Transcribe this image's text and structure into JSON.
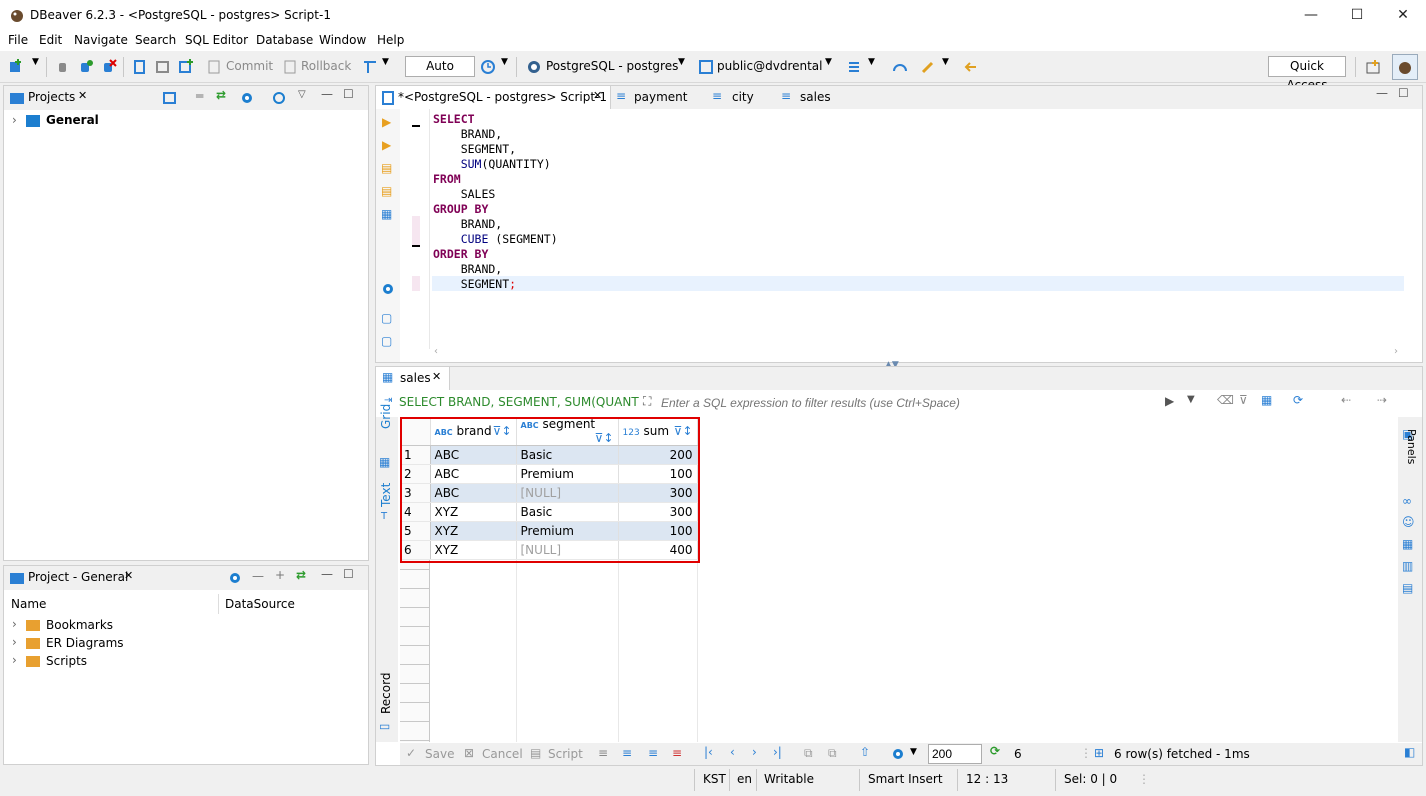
{
  "window": {
    "title": "DBeaver 6.2.3 - <PostgreSQL - postgres> Script-1",
    "minimize": "—",
    "maximize": "☐",
    "close": "✕"
  },
  "menu": [
    "File",
    "Edit",
    "Navigate",
    "Search",
    "SQL Editor",
    "Database",
    "Window",
    "Help"
  ],
  "toolbar": {
    "commit": "Commit",
    "rollback": "Rollback",
    "transaction_mode": "Auto",
    "connection": "PostgreSQL - postgres",
    "schema": "public@dvdrental",
    "quick_access": "Quick Access"
  },
  "projects_panel": {
    "title": "Projects",
    "items": [
      {
        "label": "General"
      }
    ]
  },
  "project_general_panel": {
    "title": "Project - General",
    "columns": [
      "Name",
      "DataSource"
    ],
    "items": [
      {
        "label": "Bookmarks"
      },
      {
        "label": "ER Diagrams"
      },
      {
        "label": "Scripts"
      }
    ]
  },
  "editor_tabs": [
    {
      "label": "*<PostgreSQL - postgres> Script-1",
      "active": true
    },
    {
      "label": "payment"
    },
    {
      "label": "city"
    },
    {
      "label": "sales"
    }
  ],
  "sql_lines": [
    {
      "kw": "SELECT"
    },
    {
      "text": "    BRAND,"
    },
    {
      "text": "    SEGMENT,"
    },
    {
      "fn": "    SUM",
      "text": "(QUANTITY)"
    },
    {
      "kw": "FROM"
    },
    {
      "text": "    SALES"
    },
    {
      "kw": "GROUP BY"
    },
    {
      "text": "    BRAND,"
    },
    {
      "fn": "    CUBE",
      "text": " (SEGMENT)"
    },
    {
      "kw": "ORDER BY"
    },
    {
      "text": "    BRAND,"
    },
    {
      "text": "    SEGMENT",
      "semi": ";"
    }
  ],
  "results": {
    "tab": "sales",
    "query_text": "SELECT BRAND, SEGMENT, SUM(QUANTITY",
    "filter_placeholder": "Enter a SQL expression to filter results (use Ctrl+Space)",
    "side_tabs": {
      "grid": "Grid",
      "text": "Text",
      "record": "Record",
      "panels": "Panels"
    },
    "columns": [
      {
        "type": "ABC",
        "name": "brand"
      },
      {
        "type": "ABC",
        "name": "segment"
      },
      {
        "type": "123",
        "name": "sum"
      }
    ],
    "rows": [
      {
        "n": "1",
        "brand": "ABC",
        "segment": "Basic",
        "sum": "200"
      },
      {
        "n": "2",
        "brand": "ABC",
        "segment": "Premium",
        "sum": "100"
      },
      {
        "n": "3",
        "brand": "ABC",
        "segment": "[NULL]",
        "sum": "300"
      },
      {
        "n": "4",
        "brand": "XYZ",
        "segment": "Basic",
        "sum": "300"
      },
      {
        "n": "5",
        "brand": "XYZ",
        "segment": "Premium",
        "sum": "100"
      },
      {
        "n": "6",
        "brand": "XYZ",
        "segment": "[NULL]",
        "sum": "400"
      }
    ],
    "bottom": {
      "save": "Save",
      "cancel": "Cancel",
      "script": "Script",
      "fetch_size": "200",
      "refresh_count": "6",
      "status": "6 row(s) fetched - 1ms"
    }
  },
  "statusbar": {
    "tz": "KST",
    "lang": "en",
    "mode": "Writable",
    "insert": "Smart Insert",
    "pos": "12 : 13",
    "sel": "Sel: 0 | 0"
  },
  "colors": {
    "accent": "#1c7ecf",
    "highlight": "#e00000",
    "row_selected": "#dce6f2"
  }
}
